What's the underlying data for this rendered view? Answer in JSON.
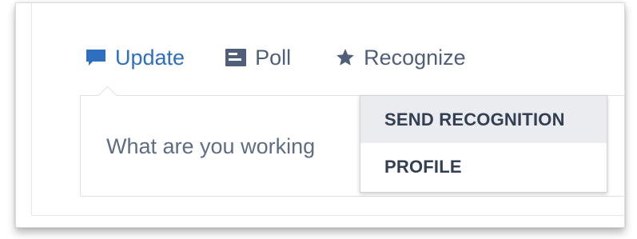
{
  "tabs": [
    {
      "label": "Update",
      "icon": "speech-bubble-icon",
      "active": true
    },
    {
      "label": "Poll",
      "icon": "poll-icon",
      "active": false
    },
    {
      "label": "Recognize",
      "icon": "star-icon",
      "active": false
    }
  ],
  "composer": {
    "placeholder": "What are you working"
  },
  "dropdown": {
    "items": [
      {
        "label": "SEND RECOGNITION",
        "highlighted": true
      },
      {
        "label": "PROFILE",
        "highlighted": false
      }
    ]
  },
  "colors": {
    "accent": "#2f6fbf",
    "tab_text": "#505f79",
    "menu_highlight": "#ebecf0"
  }
}
